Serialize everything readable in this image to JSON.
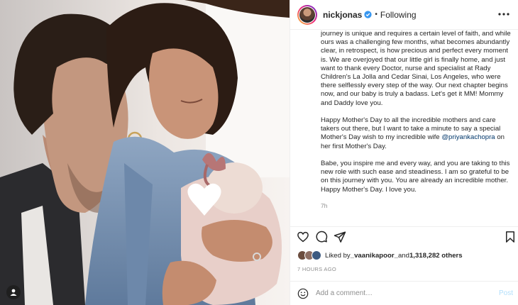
{
  "post": {
    "username": "nickjonas",
    "separator": "•",
    "follow_state": "Following",
    "caption_paragraphs": [
      "journey is unique and requires a certain level of faith, and while ours was a challenging few months, what becomes abundantly clear, in retrospect, is how precious and perfect every moment is. We are overjoyed that our little girl is finally home, and just want to thank every Doctor, nurse and specialist at Rady Children's La Jolla and Cedar Sinai, Los Angeles, who were there selflessly every step of the way. Our next chapter begins now, and our baby is truly a badass. Let's get it MM! Mommy and Daddy love you.",
      {
        "before": "Happy Mother's Day to all the incredible mothers and care takers out there, but I want to take a minute to say a special Mother's Day wish to my incredible wife ",
        "mention": "@priyankachopra",
        "after": " on her first Mother's Day."
      },
      "Babe, you inspire me and every way, and you are taking to this new role with such ease and steadiness. I am so grateful to be on this journey with you. You are already an incredible mother. Happy Mother's Day. I love you."
    ],
    "caption_time": "7h",
    "likes": {
      "prefix": "Liked by ",
      "user": "_vaanikapoor_",
      "middle": " and ",
      "count": "1,318,282 others"
    },
    "posted_ago": "7 HOURS AGO",
    "comment": {
      "placeholder": "Add a comment…",
      "value": "",
      "post_label": "Post"
    }
  },
  "icons": {
    "header": [
      "verified-badge-icon",
      "more-options-icon"
    ],
    "actions": [
      "heart-icon",
      "comment-icon",
      "share-icon",
      "bookmark-icon"
    ],
    "comment": [
      "emoji-icon"
    ],
    "photo": [
      "user-tags-icon"
    ]
  },
  "colors": {
    "link": "#00376b",
    "verified": "#3897f0",
    "secondary_text": "#8e8e8e",
    "post_button_disabled": "#b2dffc"
  }
}
